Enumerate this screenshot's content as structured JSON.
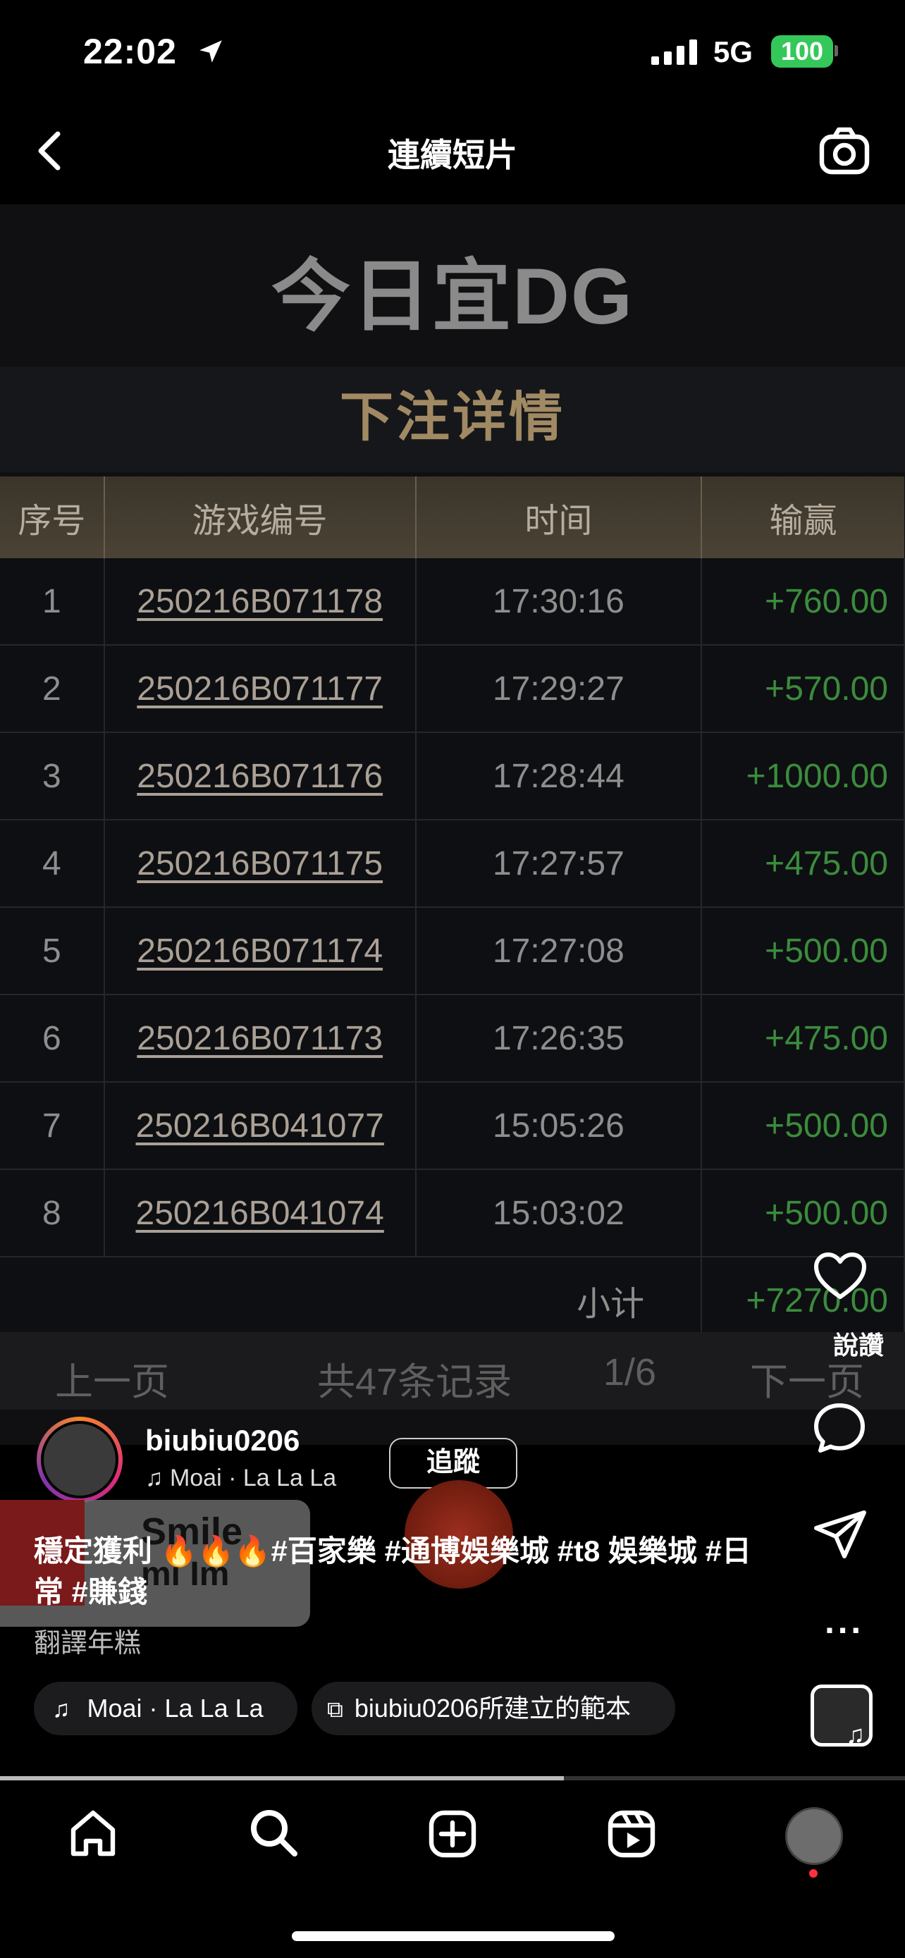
{
  "status_bar": {
    "time": "22:02",
    "network": "5G",
    "battery": "100"
  },
  "header": {
    "title": "連續短片"
  },
  "video": {
    "banner": "今日宜DG",
    "section_title": "下注详情",
    "table": {
      "headers": [
        "序号",
        "游戏编号",
        "时间",
        "输赢"
      ],
      "rows": [
        [
          "1",
          "250216B071178",
          "17:30:16",
          "+760.00"
        ],
        [
          "2",
          "250216B071177",
          "17:29:27",
          "+570.00"
        ],
        [
          "3",
          "250216B071176",
          "17:28:44",
          "+1000.00"
        ],
        [
          "4",
          "250216B071175",
          "17:27:57",
          "+475.00"
        ],
        [
          "5",
          "250216B071174",
          "17:27:08",
          "+500.00"
        ],
        [
          "6",
          "250216B071173",
          "17:26:35",
          "+475.00"
        ],
        [
          "7",
          "250216B041077",
          "15:05:26",
          "+500.00"
        ],
        [
          "8",
          "250216B041074",
          "15:03:02",
          "+500.00"
        ]
      ],
      "subtotal_label": "小计",
      "subtotal_value": "+7270.00"
    },
    "pager": {
      "prev": "上一页",
      "records": "共47条记录",
      "page": "1/6",
      "next": "下一页"
    }
  },
  "rail": {
    "like_label": "說讚"
  },
  "post": {
    "username": "biubiu0206",
    "music": "Moai · La La La",
    "follow": "追蹤",
    "caption": "穩定獲利 🔥🔥🔥#百家樂 #通博娛樂城 #t8 娛樂城 #日常 #賺錢",
    "translate": "翻譯年糕",
    "chip_music": "Moai · La La La",
    "chip_template": "biubiu0206所建立的範本",
    "popup_title": "Smile",
    "popup_sub": "mi Im"
  },
  "colors": {
    "win_green": "#3b8c3d",
    "header_gold": "#a18a63",
    "battery_green": "#34c759",
    "notify_red": "#ff3040"
  }
}
